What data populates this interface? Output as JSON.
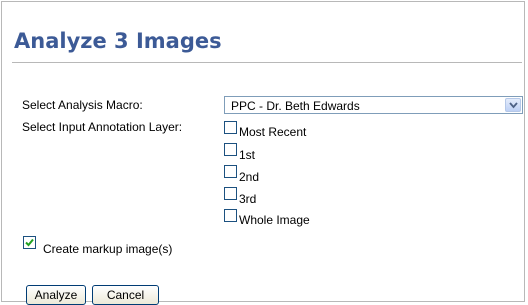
{
  "title": "Analyze 3 Images",
  "form": {
    "macro_label": "Select Analysis Macro:",
    "macro_selected": "PPC - Dr. Beth Edwards",
    "layer_label": "Select Input Annotation Layer:",
    "layers": [
      {
        "label": "Most Recent",
        "checked": false
      },
      {
        "label": "1st",
        "checked": false
      },
      {
        "label": "2nd",
        "checked": false
      },
      {
        "label": "3rd",
        "checked": false
      },
      {
        "label": "Whole Image",
        "checked": false
      }
    ],
    "markup_label": "Create markup image(s)",
    "markup_checked": true
  },
  "buttons": {
    "analyze": "Analyze",
    "cancel": "Cancel"
  },
  "colors": {
    "title": "#3c5a96",
    "checkbox_border": "#1c5180",
    "checkmark": "#21a121",
    "select_border": "#7f9db9"
  },
  "icons": {
    "dropdown": "chevron-down-icon",
    "check": "checkmark-icon"
  }
}
